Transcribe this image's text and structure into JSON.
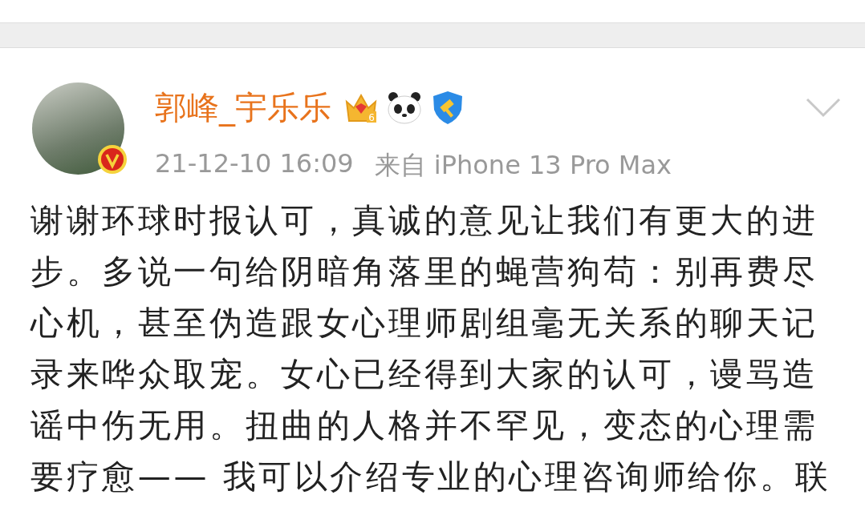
{
  "post": {
    "author": "郭峰_宇乐乐",
    "verified": true,
    "badges": [
      {
        "kind": "crown",
        "level": "6"
      },
      {
        "kind": "panda"
      },
      {
        "kind": "shield"
      }
    ],
    "time": "21-12-10 16:09",
    "source": "来自 iPhone 13 Pro Max",
    "text": "谢谢环球时报认可，真诚的意见让我们有更大的进步。多说一句给阴暗角落里的蝇营狗苟：别再费尽心机，甚至伪造跟女心理师剧组毫无关系的聊天记录来哗众取宠。女心已经得到大家的认可，谩骂造谣中伤无用。扭曲的人格并不罕见，变态的心理需要疗愈—— 我可以介绍专业的心理咨询师给你。联"
  }
}
